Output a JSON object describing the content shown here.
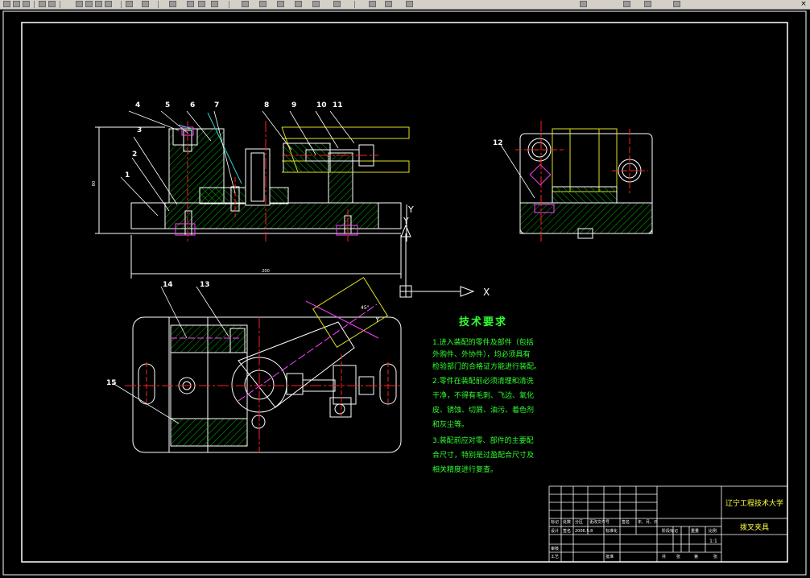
{
  "toolbar": {
    "icons": [
      "new-icon",
      "open-icon",
      "save-icon",
      "print-icon",
      "preview-icon",
      "cut-icon",
      "copy-icon",
      "paste-icon",
      "match-icon",
      "undo-icon",
      "redo-icon",
      "pan-icon",
      "zoom-icon",
      "zoom-window-icon",
      "zoom-prev-icon",
      "properties-icon",
      "design-center-icon",
      "tool-palette-icon",
      "help-icon"
    ],
    "close_glyph": "×"
  },
  "drawing": {
    "part_labels": {
      "p1": "1",
      "p2": "2",
      "p3": "3",
      "p4": "4",
      "p5": "5",
      "p6": "6",
      "p7": "7",
      "p8": "8",
      "p9": "9",
      "p10": "10",
      "p11": "11",
      "p12": "12",
      "p13": "13",
      "p14": "14",
      "p15": "15"
    },
    "dim_width": "200",
    "dim_height": "80",
    "angle_label": "45°",
    "ucs": {
      "x": "X",
      "y": "Y"
    },
    "section_y": "Y"
  },
  "tech_requirements": {
    "title": "技术要求",
    "lines": [
      "1.进入装配的零件及部件（包括",
      "外购件、外协件），均必须具有",
      "检验部门的合格证方能进行装配。",
      "2.零件在装配前必须清理和清洗",
      "干净，不得有毛刺、飞边、氧化",
      "皮、锈蚀、切屑、油污、着色剂",
      "和灰尘等。",
      "3.装配前应对零、部件的主要配",
      "合尺寸，特别是过盈配合尺寸及",
      "相关精度进行复查。"
    ]
  },
  "title_block": {
    "school": "辽宁工程技术大学",
    "drawing_name": "拨叉夹具",
    "scale": "1:1",
    "row_mark": [
      "标记",
      "处数",
      "分区",
      "更改文件号",
      "签名",
      "年、月、日"
    ],
    "row_design": [
      "设计",
      "签名",
      "2006.5.8",
      "标准化"
    ],
    "stage_label": "阶段标记",
    "weight_label": "重量",
    "scale_label": "比例",
    "review": "审核",
    "process": "工艺",
    "approve": "批准",
    "sheet_total": "共",
    "sheet_unit": "张",
    "sheet_no": "第",
    "sheet_unit2": "张"
  },
  "colors": {
    "background": "#000000",
    "frame": "#ffffff",
    "hatch": "#00cc00",
    "center": "#ff2020",
    "magenta": "#ff40ff",
    "yellow": "#e0e020",
    "cyan": "#30d0d0",
    "text_green": "#30ff30",
    "text_yellow": "#ffff40"
  }
}
